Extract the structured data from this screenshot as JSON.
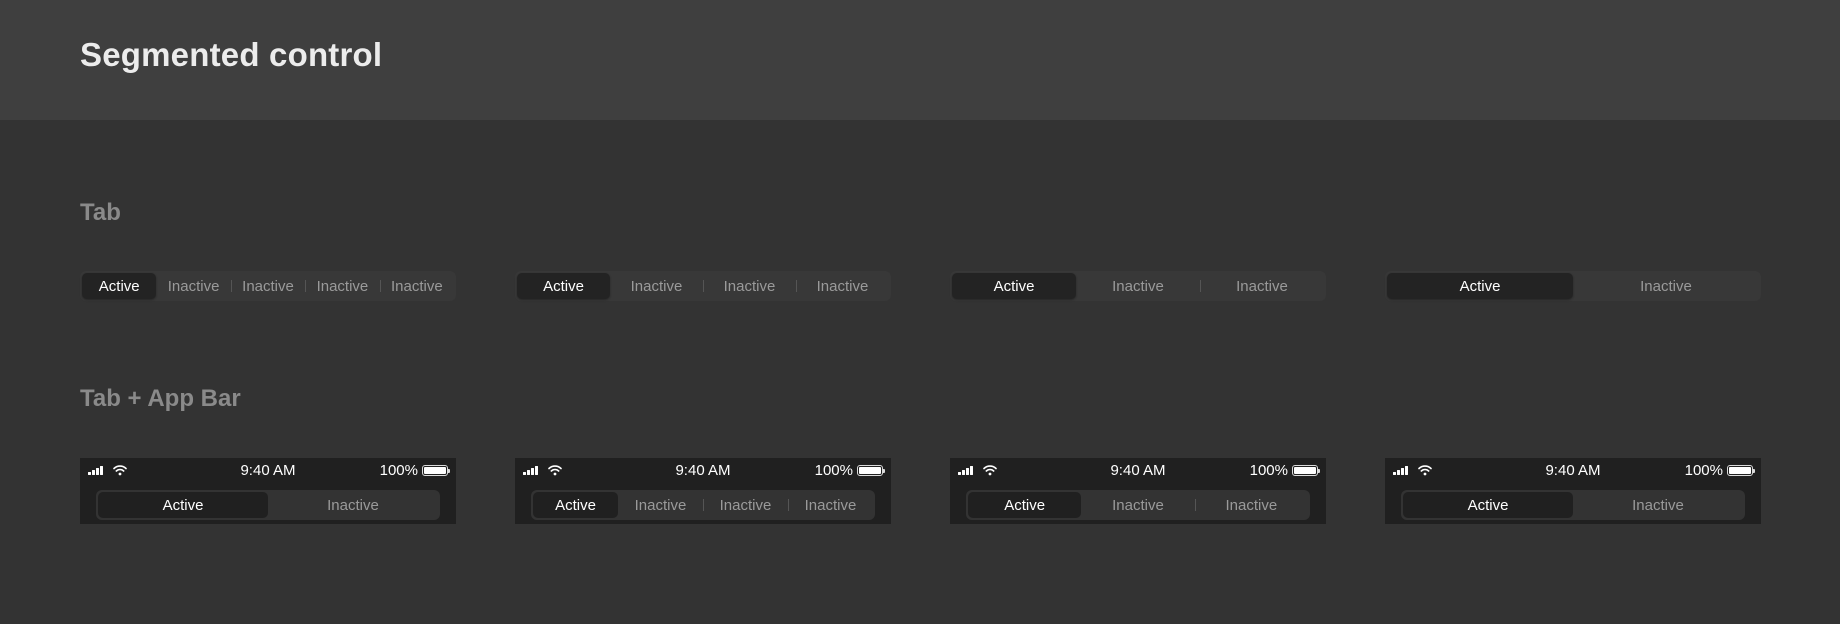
{
  "header": {
    "title": "Segmented control"
  },
  "sections": {
    "tab": "Tab",
    "tab_appbar": "Tab + App Bar"
  },
  "tab_controls": [
    {
      "items": [
        "Active",
        "Inactive",
        "Inactive",
        "Inactive",
        "Inactive"
      ]
    },
    {
      "items": [
        "Active",
        "Inactive",
        "Inactive",
        "Inactive"
      ]
    },
    {
      "items": [
        "Active",
        "Inactive",
        "Inactive"
      ]
    },
    {
      "items": [
        "Active",
        "Inactive"
      ]
    }
  ],
  "appbar_controls": [
    {
      "time": "9:40 AM",
      "battery": "100%",
      "items": [
        "Active",
        "Inactive"
      ]
    },
    {
      "time": "9:40 AM",
      "battery": "100%",
      "items": [
        "Active",
        "Inactive",
        "Inactive",
        "Inactive"
      ]
    },
    {
      "time": "9:40 AM",
      "battery": "100%",
      "items": [
        "Active",
        "Inactive",
        "Inactive"
      ]
    },
    {
      "time": "9:40 AM",
      "battery": "100%",
      "items": [
        "Active",
        "Inactive"
      ]
    }
  ],
  "colors": {
    "background": "#333333",
    "header": "#3f3f3f",
    "active_segment": "#232323"
  },
  "icons": [
    "signal-icon",
    "wifi-icon",
    "battery-icon"
  ]
}
